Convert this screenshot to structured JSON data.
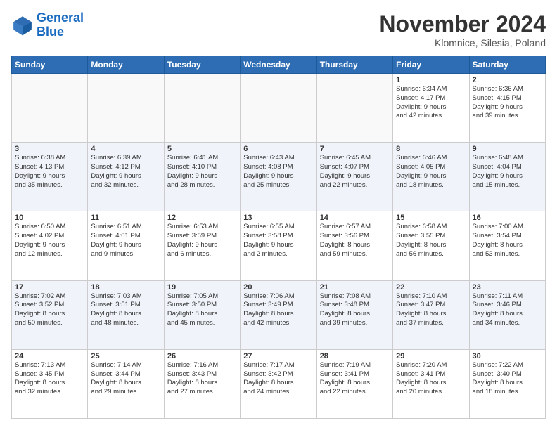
{
  "logo": {
    "line1": "General",
    "line2": "Blue"
  },
  "title": "November 2024",
  "subtitle": "Klomnice, Silesia, Poland",
  "days_of_week": [
    "Sunday",
    "Monday",
    "Tuesday",
    "Wednesday",
    "Thursday",
    "Friday",
    "Saturday"
  ],
  "weeks": [
    {
      "shaded": false,
      "days": [
        {
          "num": "",
          "info": ""
        },
        {
          "num": "",
          "info": ""
        },
        {
          "num": "",
          "info": ""
        },
        {
          "num": "",
          "info": ""
        },
        {
          "num": "",
          "info": ""
        },
        {
          "num": "1",
          "info": "Sunrise: 6:34 AM\nSunset: 4:17 PM\nDaylight: 9 hours\nand 42 minutes."
        },
        {
          "num": "2",
          "info": "Sunrise: 6:36 AM\nSunset: 4:15 PM\nDaylight: 9 hours\nand 39 minutes."
        }
      ]
    },
    {
      "shaded": true,
      "days": [
        {
          "num": "3",
          "info": "Sunrise: 6:38 AM\nSunset: 4:13 PM\nDaylight: 9 hours\nand 35 minutes."
        },
        {
          "num": "4",
          "info": "Sunrise: 6:39 AM\nSunset: 4:12 PM\nDaylight: 9 hours\nand 32 minutes."
        },
        {
          "num": "5",
          "info": "Sunrise: 6:41 AM\nSunset: 4:10 PM\nDaylight: 9 hours\nand 28 minutes."
        },
        {
          "num": "6",
          "info": "Sunrise: 6:43 AM\nSunset: 4:08 PM\nDaylight: 9 hours\nand 25 minutes."
        },
        {
          "num": "7",
          "info": "Sunrise: 6:45 AM\nSunset: 4:07 PM\nDaylight: 9 hours\nand 22 minutes."
        },
        {
          "num": "8",
          "info": "Sunrise: 6:46 AM\nSunset: 4:05 PM\nDaylight: 9 hours\nand 18 minutes."
        },
        {
          "num": "9",
          "info": "Sunrise: 6:48 AM\nSunset: 4:04 PM\nDaylight: 9 hours\nand 15 minutes."
        }
      ]
    },
    {
      "shaded": false,
      "days": [
        {
          "num": "10",
          "info": "Sunrise: 6:50 AM\nSunset: 4:02 PM\nDaylight: 9 hours\nand 12 minutes."
        },
        {
          "num": "11",
          "info": "Sunrise: 6:51 AM\nSunset: 4:01 PM\nDaylight: 9 hours\nand 9 minutes."
        },
        {
          "num": "12",
          "info": "Sunrise: 6:53 AM\nSunset: 3:59 PM\nDaylight: 9 hours\nand 6 minutes."
        },
        {
          "num": "13",
          "info": "Sunrise: 6:55 AM\nSunset: 3:58 PM\nDaylight: 9 hours\nand 2 minutes."
        },
        {
          "num": "14",
          "info": "Sunrise: 6:57 AM\nSunset: 3:56 PM\nDaylight: 8 hours\nand 59 minutes."
        },
        {
          "num": "15",
          "info": "Sunrise: 6:58 AM\nSunset: 3:55 PM\nDaylight: 8 hours\nand 56 minutes."
        },
        {
          "num": "16",
          "info": "Sunrise: 7:00 AM\nSunset: 3:54 PM\nDaylight: 8 hours\nand 53 minutes."
        }
      ]
    },
    {
      "shaded": true,
      "days": [
        {
          "num": "17",
          "info": "Sunrise: 7:02 AM\nSunset: 3:52 PM\nDaylight: 8 hours\nand 50 minutes."
        },
        {
          "num": "18",
          "info": "Sunrise: 7:03 AM\nSunset: 3:51 PM\nDaylight: 8 hours\nand 48 minutes."
        },
        {
          "num": "19",
          "info": "Sunrise: 7:05 AM\nSunset: 3:50 PM\nDaylight: 8 hours\nand 45 minutes."
        },
        {
          "num": "20",
          "info": "Sunrise: 7:06 AM\nSunset: 3:49 PM\nDaylight: 8 hours\nand 42 minutes."
        },
        {
          "num": "21",
          "info": "Sunrise: 7:08 AM\nSunset: 3:48 PM\nDaylight: 8 hours\nand 39 minutes."
        },
        {
          "num": "22",
          "info": "Sunrise: 7:10 AM\nSunset: 3:47 PM\nDaylight: 8 hours\nand 37 minutes."
        },
        {
          "num": "23",
          "info": "Sunrise: 7:11 AM\nSunset: 3:46 PM\nDaylight: 8 hours\nand 34 minutes."
        }
      ]
    },
    {
      "shaded": false,
      "days": [
        {
          "num": "24",
          "info": "Sunrise: 7:13 AM\nSunset: 3:45 PM\nDaylight: 8 hours\nand 32 minutes."
        },
        {
          "num": "25",
          "info": "Sunrise: 7:14 AM\nSunset: 3:44 PM\nDaylight: 8 hours\nand 29 minutes."
        },
        {
          "num": "26",
          "info": "Sunrise: 7:16 AM\nSunset: 3:43 PM\nDaylight: 8 hours\nand 27 minutes."
        },
        {
          "num": "27",
          "info": "Sunrise: 7:17 AM\nSunset: 3:42 PM\nDaylight: 8 hours\nand 24 minutes."
        },
        {
          "num": "28",
          "info": "Sunrise: 7:19 AM\nSunset: 3:41 PM\nDaylight: 8 hours\nand 22 minutes."
        },
        {
          "num": "29",
          "info": "Sunrise: 7:20 AM\nSunset: 3:41 PM\nDaylight: 8 hours\nand 20 minutes."
        },
        {
          "num": "30",
          "info": "Sunrise: 7:22 AM\nSunset: 3:40 PM\nDaylight: 8 hours\nand 18 minutes."
        }
      ]
    }
  ]
}
